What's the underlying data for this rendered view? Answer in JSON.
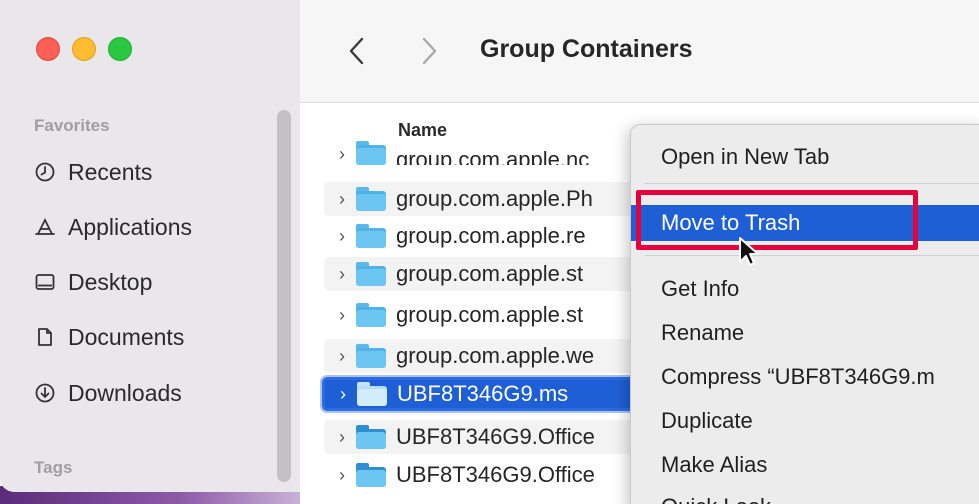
{
  "window": {
    "title": "Group Containers"
  },
  "toolbar": {
    "back_icon": "chevron-left-icon",
    "forward_icon": "chevron-right-icon"
  },
  "sidebar": {
    "favorites_label": "Favorites",
    "tags_label": "Tags",
    "items": [
      {
        "label": "Recents",
        "icon": "clock-icon"
      },
      {
        "label": "Applications",
        "icon": "applications-icon"
      },
      {
        "label": "Desktop",
        "icon": "desktop-icon"
      },
      {
        "label": "Documents",
        "icon": "document-icon"
      },
      {
        "label": "Downloads",
        "icon": "download-icon"
      }
    ]
  },
  "filelist": {
    "column_name": "Name",
    "rows": [
      {
        "name": "group.com.apple.nc"
      },
      {
        "name": "group.com.apple.Ph"
      },
      {
        "name": "group.com.apple.re"
      },
      {
        "name": "group.com.apple.st"
      },
      {
        "name": "group.com.apple.st"
      },
      {
        "name": "group.com.apple.we"
      },
      {
        "name": "UBF8T346G9.ms"
      },
      {
        "name": "UBF8T346G9.Office"
      },
      {
        "name": "UBF8T346G9.Office"
      }
    ]
  },
  "context_menu": {
    "items": [
      {
        "label": "Open in New Tab"
      },
      {
        "label": "Move to Trash"
      },
      {
        "label": "Get Info"
      },
      {
        "label": "Rename"
      },
      {
        "label": "Compress “UBF8T346G9.m"
      },
      {
        "label": "Duplicate"
      },
      {
        "label": "Make Alias"
      },
      {
        "label": "Quick Look"
      }
    ]
  },
  "colors": {
    "accent": "#1f5fd6",
    "highlight_box": "#e4003a"
  }
}
